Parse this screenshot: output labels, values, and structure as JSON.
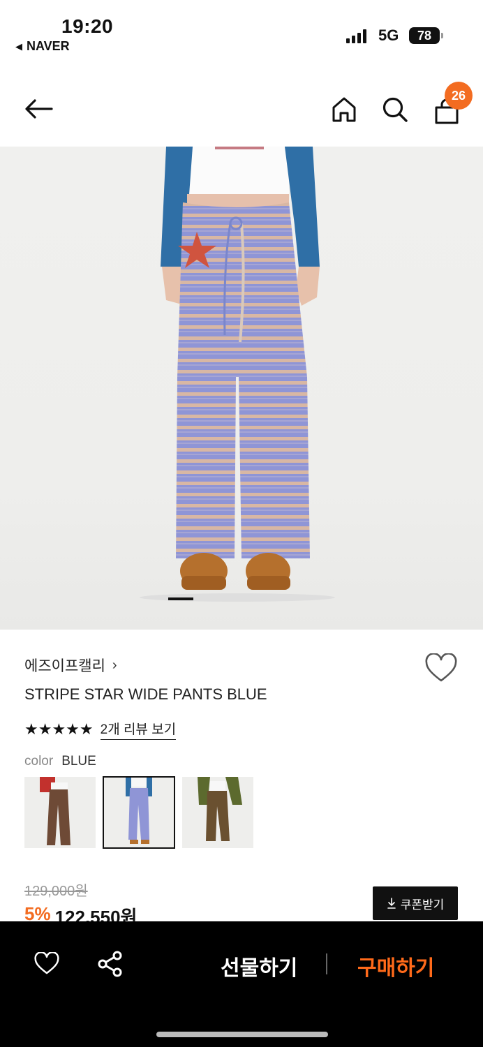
{
  "status_bar": {
    "time": "19:20",
    "back_app": "NAVER",
    "network": "5G",
    "battery": "78"
  },
  "header": {
    "back_icon": "arrow-left-icon",
    "home_icon": "home-icon",
    "search_icon": "search-icon",
    "cart_icon": "shopping-bag-icon",
    "cart_count": "26",
    "accent": "#f36c21"
  },
  "product": {
    "brand": "에즈이프캘리",
    "brand_chevron": "›",
    "name": "STRIPE STAR WIDE PANTS BLUE",
    "rating": 5,
    "stars": "★★★★★",
    "review_link": "2개 리뷰 보기",
    "color_label": "color",
    "color_value": "BLUE",
    "thumbnails": [
      {
        "variant": "brown",
        "selected": false
      },
      {
        "variant": "blue",
        "selected": true
      },
      {
        "variant": "olive",
        "selected": false
      }
    ],
    "original_price": "129,000원",
    "discount": "5%",
    "sale_price": "122,550원",
    "coupon_label": "쿠폰받기"
  },
  "bottom_bar": {
    "wishlist_icon": "heart-icon",
    "share_icon": "share-icon",
    "gift_label": "선물하기",
    "buy_label": "구매하기",
    "buy_color": "#ff6a1a"
  }
}
